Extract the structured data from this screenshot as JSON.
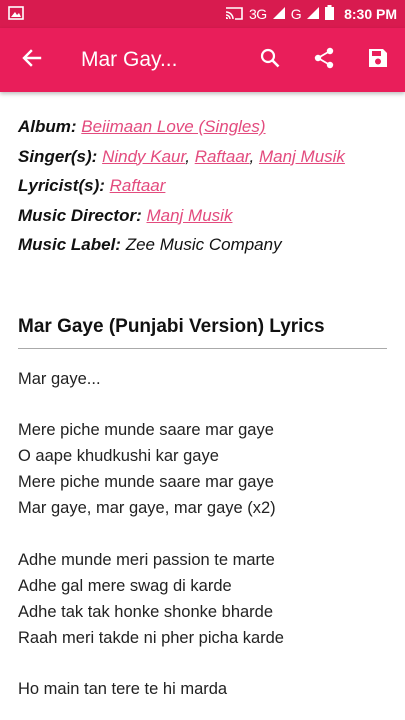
{
  "status_bar": {
    "network": "3G",
    "network2": "G",
    "time": "8:30",
    "ampm": "PM"
  },
  "app_bar": {
    "title": "Mar Gay..."
  },
  "meta": {
    "album_label": "Album:",
    "album_value": "Beiimaan Love (Singles)",
    "singers_label": "Singer(s):",
    "singers": [
      "Nindy Kaur",
      "Raftaar",
      "Manj Musik"
    ],
    "lyricist_label": "Lyricist(s):",
    "lyricist_value": "Raftaar",
    "director_label": "Music Director:",
    "director_value": "Manj Musik",
    "music_label_label": "Music Label:",
    "music_label_value": "Zee Music Company"
  },
  "lyrics_title": "Mar Gaye (Punjabi Version) Lyrics",
  "lyrics": {
    "s0": [
      "Mar gaye..."
    ],
    "s1": [
      "Mere piche munde saare mar gaye",
      "O aape khudkushi kar gaye",
      "Mere piche munde saare mar gaye",
      "Mar gaye, mar gaye, mar gaye (x2)"
    ],
    "s2": [
      "Adhe munde meri passion te marte",
      "Adhe gal mere swag di karde",
      "Adhe tak tak honke shonke bharde",
      "Raah meri takde ni pher picha karde"
    ],
    "s3": [
      "Ho main tan tere te hi marda"
    ]
  }
}
